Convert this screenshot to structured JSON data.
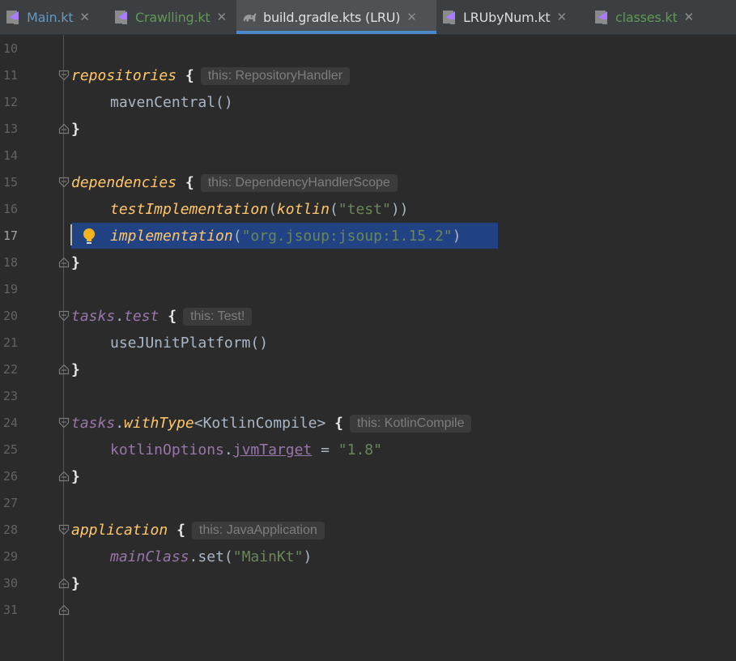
{
  "tabs": [
    {
      "label": "Main.kt",
      "color": "#6897bb",
      "icon": "kotlin-file-icon",
      "active": false
    },
    {
      "label": "Crawlling.kt",
      "color": "#629755",
      "icon": "kotlin-file-icon",
      "active": false
    },
    {
      "label": "build.gradle.kts (LRU)",
      "color": "#e0e0e0",
      "icon": "gradle-elephant-icon",
      "active": true
    },
    {
      "label": "LRUbyNum.kt",
      "color": "#dcdcdc",
      "icon": "kotlin-file-icon",
      "active": false
    },
    {
      "label": "classes.kt",
      "color": "#629755",
      "icon": "kotlin-file-icon",
      "active": false
    }
  ],
  "close_glyph": "✕",
  "lines": {
    "l10": {
      "num": "10"
    },
    "l11": {
      "num": "11",
      "fn": "repositories",
      "brace": "{",
      "hint": "this: RepositoryHandler"
    },
    "l12": {
      "num": "12",
      "call": "mavenCentral()"
    },
    "l13": {
      "num": "13",
      "brace": "}"
    },
    "l14": {
      "num": "14"
    },
    "l15": {
      "num": "15",
      "fn": "dependencies",
      "brace": "{",
      "hint": "this: DependencyHandlerScope"
    },
    "l16": {
      "num": "16",
      "fn": "testImplementation",
      "open": "(",
      "fn2": "kotlin",
      "open2": "(",
      "str": "\"test\"",
      "close": "))"
    },
    "l17": {
      "num": "17",
      "fn": "implementation",
      "open": "(",
      "str": "\"org.jsoup:jsoup:1.15.2\"",
      "close": ")"
    },
    "l18": {
      "num": "18",
      "brace": "}"
    },
    "l19": {
      "num": "19"
    },
    "l20": {
      "num": "20",
      "obj": "tasks",
      "dot": ".",
      "prop": "test",
      "brace": "{",
      "hint": "this: Test!"
    },
    "l21": {
      "num": "21",
      "call": "useJUnitPlatform()"
    },
    "l22": {
      "num": "22",
      "brace": "}"
    },
    "l23": {
      "num": "23"
    },
    "l24": {
      "num": "24",
      "obj": "tasks",
      "dot": ".",
      "fn": "withType",
      "generic": "<KotlinCompile>",
      "brace": "{",
      "hint": "this: KotlinCompile"
    },
    "l25": {
      "num": "25",
      "obj": "kotlinOptions",
      "dot": ".",
      "prop": "jvmTarget",
      "eq": " = ",
      "str": "\"1.8\""
    },
    "l26": {
      "num": "26",
      "brace": "}"
    },
    "l27": {
      "num": "27"
    },
    "l28": {
      "num": "28",
      "fn": "application",
      "brace": "{",
      "hint": "this: JavaApplication"
    },
    "l29": {
      "num": "29",
      "obj": "mainClass",
      "dot": ".",
      "call": "set(",
      "str": "\"MainKt\"",
      "close": ")"
    },
    "l30": {
      "num": "30",
      "brace": "}"
    },
    "l31": {
      "num": "31"
    }
  }
}
